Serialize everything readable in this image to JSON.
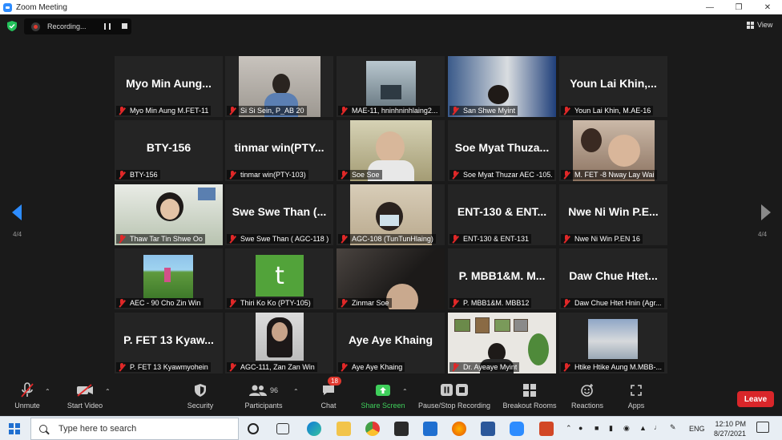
{
  "window": {
    "title": "Zoom Meeting",
    "minimize_icon": "minimize-icon",
    "restore_icon": "restore-icon",
    "close_icon": "close-icon"
  },
  "recording": {
    "status": "Recording..."
  },
  "view": {
    "label": "View"
  },
  "pager": {
    "left": "4/4",
    "right": "4/4"
  },
  "participants": [
    {
      "big": "Myo Min Aung...",
      "caption": "Myo Min Aung M.FET-11",
      "video": false
    },
    {
      "big": "",
      "caption": "Si Si Sein, P_AB 20",
      "video": true
    },
    {
      "big": "",
      "caption": "MAE-11, hninhninhlaing2...",
      "video": true
    },
    {
      "big": "",
      "caption": "San Shwe Myint",
      "video": true
    },
    {
      "big": "Youn Lai Khin,...",
      "caption": "Youn Lai Khin, M.AE-16",
      "video": false
    },
    {
      "big": "BTY-156",
      "caption": "BTY-156",
      "video": false
    },
    {
      "big": "tinmar win(PTY...",
      "caption": "tinmar win(PTY-103)",
      "video": false
    },
    {
      "big": "",
      "caption": "Soe Soe",
      "video": true
    },
    {
      "big": "Soe Myat Thuza...",
      "caption": "Soe Myat Thuzar AEC -105.",
      "video": false
    },
    {
      "big": "",
      "caption": "M. FET -8 Nway Lay Wai",
      "video": true
    },
    {
      "big": "",
      "caption": "Thaw Tar Tin Shwe Oo",
      "video": true
    },
    {
      "big": "Swe Swe Than (...",
      "caption": "Swe Swe Than ( AGC-118 )",
      "video": false
    },
    {
      "big": "",
      "caption": "AGC-108 (TunTunHlaing)",
      "video": true
    },
    {
      "big": "ENT-130 & ENT...",
      "caption": "ENT-130 & ENT-131",
      "video": false
    },
    {
      "big": "Nwe Ni Win P.E...",
      "caption": "Nwe Ni Win P.EN 16",
      "video": false
    },
    {
      "big": "",
      "caption": "AEC - 90 Cho Zin Win",
      "video": true
    },
    {
      "big": "",
      "caption": "Thiri Ko Ko (PTY-105)",
      "video": true,
      "avatar_letter": "t"
    },
    {
      "big": "",
      "caption": "Zinmar Soe",
      "video": true
    },
    {
      "big": "P. MBB1&M. M...",
      "caption": "P. MBB1&M. MBB12",
      "video": false
    },
    {
      "big": "Daw Chue Htet...",
      "caption": "Daw Chue Htet Hnin (Agr...",
      "video": false
    },
    {
      "big": "P. FET 13 Kyaw...",
      "caption": "P. FET 13 Kyawmyohein",
      "video": false
    },
    {
      "big": "",
      "caption": "AGC-111, Zan Zan Win",
      "video": true
    },
    {
      "big": "Aye Aye Khaing",
      "caption": "Aye Aye Khaing",
      "video": false
    },
    {
      "big": "",
      "caption": "Dr. Ayeaye Myint",
      "video": true
    },
    {
      "big": "",
      "caption": "Htike Htike Aung M.MBB-...",
      "video": true
    }
  ],
  "toolbar": {
    "unmute": "Unmute",
    "start_video": "Start Video",
    "security": "Security",
    "participants": "Participants",
    "participants_count": "96",
    "chat": "Chat",
    "chat_badge": "18",
    "share_screen": "Share Screen",
    "pause_recording": "Pause/Stop Recording",
    "breakout_rooms": "Breakout Rooms",
    "reactions": "Reactions",
    "apps": "Apps",
    "leave": "Leave"
  },
  "taskbar": {
    "search_placeholder": "Type here to search",
    "lang": "ENG",
    "time": "12:10 PM",
    "date": "8/27/2021"
  },
  "colors": {
    "accent_blue": "#2d8cff",
    "leave_red": "#d9262a",
    "share_green": "#3fcf5b",
    "muted_red": "#e02828"
  }
}
